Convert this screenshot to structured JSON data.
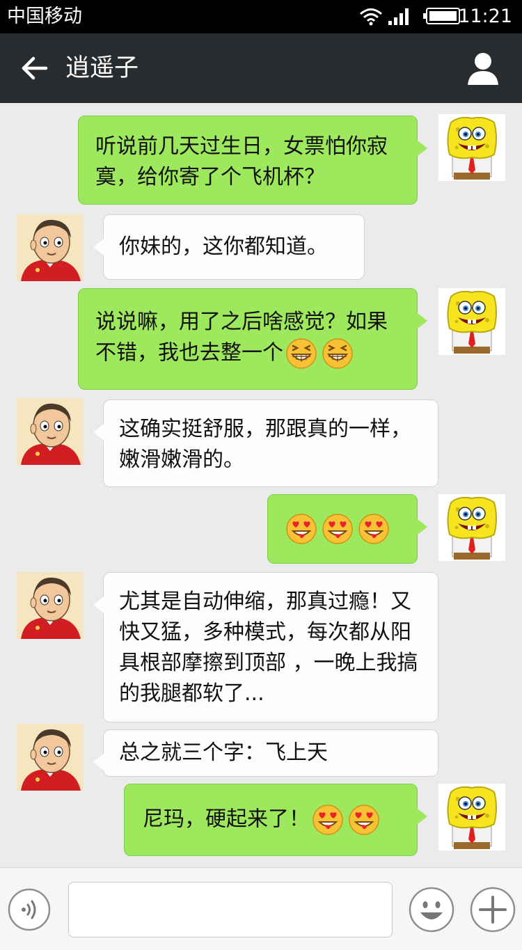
{
  "status": {
    "carrier": "中国移动",
    "time": "11:21"
  },
  "header": {
    "title": "逍遥子"
  },
  "messages": [
    {
      "from": "me",
      "text": "听说前几天过生日，女票怕你寂寞，给你寄了个飞机杯？"
    },
    {
      "from": "friend",
      "text": "你妹的，这你都知道。"
    },
    {
      "from": "me",
      "text": "说说嘛，用了之后啥感觉？如果不错，我也去整一个",
      "emoji": [
        "grin-emoji",
        "grin-emoji"
      ]
    },
    {
      "from": "friend",
      "text": "这确实挺舒服，那跟真的一样，嫩滑嫩滑的。"
    },
    {
      "from": "me",
      "text": "",
      "emoji": [
        "heart-eyes-emoji",
        "heart-eyes-emoji",
        "heart-eyes-emoji"
      ]
    },
    {
      "from": "friend",
      "text": "尤其是自动伸缩，那真过瘾！又快又猛，多种模式，每次都从阳具根部摩擦到顶部 ，一晚上我搞的我腿都软了..."
    },
    {
      "from": "friend",
      "text": "总之就三个字：飞上天"
    },
    {
      "from": "me",
      "text": "尼玛，硬起来了！",
      "emoji": [
        "heart-eyes-emoji",
        "heart-eyes-emoji"
      ]
    }
  ],
  "icons": {
    "back": "arrow-left-icon",
    "profile": "person-icon",
    "voice": "voice-icon",
    "emoji": "smiley-icon",
    "plus": "plus-icon"
  },
  "colors": {
    "my_bubble": "#9ee85d",
    "friend_bubble": "#fdfdfd",
    "header_bg": "#282c2f",
    "chat_bg": "#ebebeb"
  }
}
